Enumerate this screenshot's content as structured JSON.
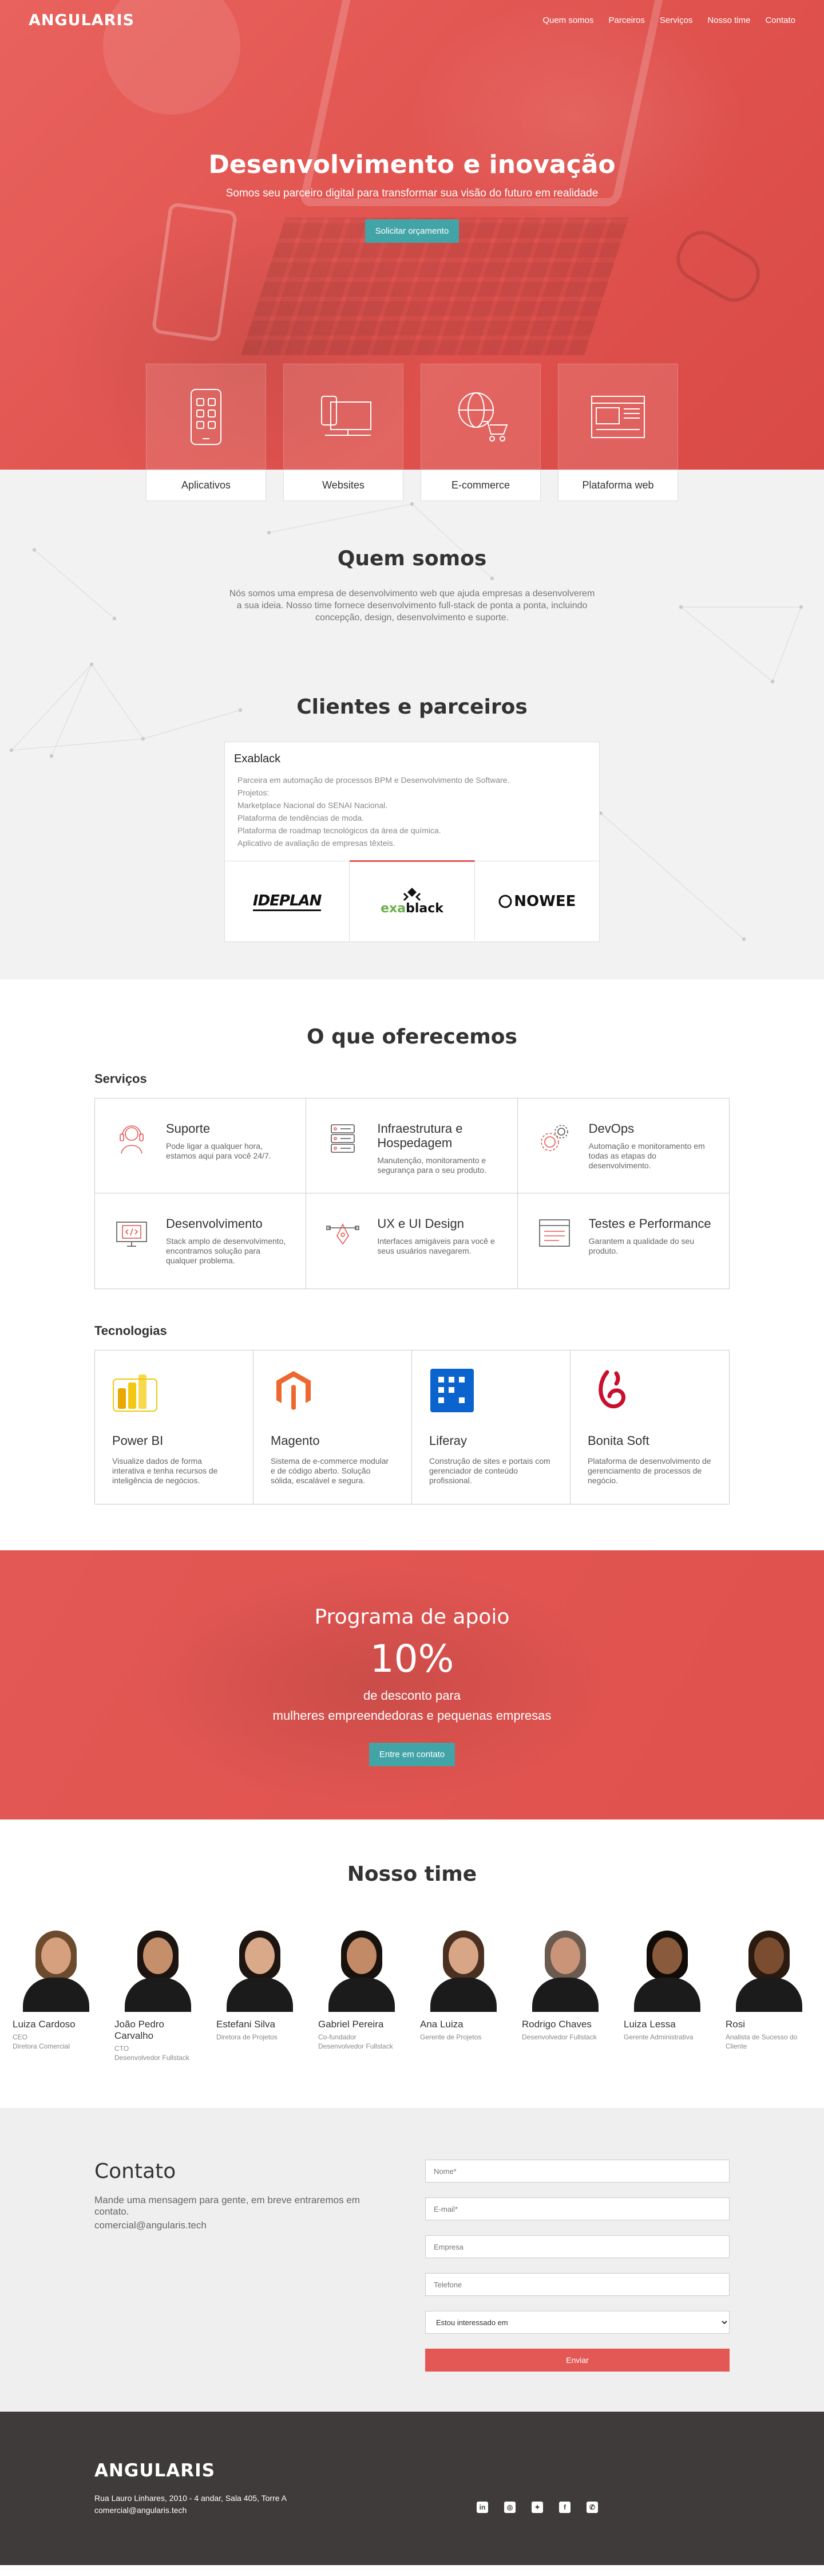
{
  "nav": {
    "logo": "ANGULARIS",
    "links": [
      "Quem somos",
      "Parceiros",
      "Serviços",
      "Nosso time",
      "Contato"
    ]
  },
  "hero": {
    "title": "Desenvolvimento e inovação",
    "subtitle": "Somos seu parceiro digital para transformar sua visão do futuro em realidade",
    "cta": "Solicitar orçamento"
  },
  "cards": [
    {
      "label": "Aplicativos",
      "icon": "mobile-app-icon"
    },
    {
      "label": "Websites",
      "icon": "desktop-icon"
    },
    {
      "label": "E-commerce",
      "icon": "shopping-cart-globe-icon"
    },
    {
      "label": "Plataforma web",
      "icon": "web-platform-icon"
    }
  ],
  "about": {
    "title": "Quem somos",
    "text": "Nós somos uma empresa de desenvolvimento web que ajuda empresas a desenvolverem a sua ideia. Nosso time fornece desenvolvimento full-stack de ponta a ponta, incluindo concepção, design, desenvolvimento e suporte."
  },
  "clients": {
    "title": "Clientes e parceiros",
    "active": "Exablack",
    "items": [
      "Parceira em automação de processos BPM e Desenvolvimento de Software.",
      "Projetos:",
      "Marketplace Nacional do SENAI Nacional.",
      "Plataforma de tendências de moda.",
      "Plataforma de roadmap tecnológicos da área de química.",
      "Aplicativo de avaliação de empresas têxteis."
    ],
    "logos": [
      "IDEPLAN",
      "exablack",
      "NOWEE"
    ]
  },
  "offer": {
    "title": "O que oferecemos",
    "services_title": "Serviços",
    "tech_title": "Tecnologias",
    "services": [
      {
        "name": "Suporte",
        "desc": "Pode ligar a qualquer hora, estamos aqui para você 24/7."
      },
      {
        "name": "Infraestrutura e Hospedagem",
        "desc": "Manutenção, monitoramento e segurança para o seu produto."
      },
      {
        "name": "DevOps",
        "desc": "Automação e monitoramento em todas as etapas do desenvolvimento."
      },
      {
        "name": "Desenvolvimento",
        "desc": "Stack amplo de desenvolvimento, encontramos solução para qualquer problema."
      },
      {
        "name": "UX e UI Design",
        "desc": "Interfaces amigáveis para você e seus usuários navegarem."
      },
      {
        "name": "Testes e Performance",
        "desc": "Garantem a qualidade do seu produto."
      }
    ],
    "techs": [
      {
        "name": "Power BI",
        "desc": "Visualize dados de forma interativa e tenha recursos de inteligência de negócios.",
        "color": "#f2c811"
      },
      {
        "name": "Magento",
        "desc": "Sistema de e-commerce modular e de código aberto. Solução sólida, escalável e segura.",
        "color": "#ee672f"
      },
      {
        "name": "Liferay",
        "desc": "Construção de sites e portais com gerenciador de conteúdo profissional.",
        "color": "#0b63ce"
      },
      {
        "name": "Bonita Soft",
        "desc": "Plataforma de desenvolvimento de gerenciamento de processos de negócio.",
        "color": "#c8102e"
      }
    ]
  },
  "promo": {
    "title": "Programa de apoio",
    "percent": "10%",
    "line1": "de desconto para",
    "line2": "mulheres empreendedoras e pequenas empresas",
    "cta": "Entre em contato"
  },
  "team": {
    "title": "Nosso time",
    "members": [
      {
        "name": "Luiza Cardoso",
        "role1": "CEO",
        "role2": "Diretora Comercial",
        "hair": "#6b4a2e",
        "skin": "#d6a07e"
      },
      {
        "name": "João Pedro Carvalho",
        "role1": "CTO",
        "role2": "Desenvolvedor Fullstack",
        "hair": "#1c1410",
        "skin": "#c58f6c"
      },
      {
        "name": "Estefani Silva",
        "role1": "Diretora de Projetos",
        "role2": "",
        "hair": "#1d1511",
        "skin": "#d9a98a"
      },
      {
        "name": "Gabriel Pereira",
        "role1": "Co-fundador",
        "role2": "Desenvolvedor Fullstack",
        "hair": "#18120e",
        "skin": "#c28a66"
      },
      {
        "name": "Ana Luiza",
        "role1": "Gerente de Projetos",
        "role2": "",
        "hair": "#4a3020",
        "skin": "#d8a586"
      },
      {
        "name": "Rodrigo Chaves",
        "role1": "Desenvolvedor Fullstack",
        "role2": "",
        "hair": "#6a5a50",
        "skin": "#c99477"
      },
      {
        "name": "Luiza Lessa",
        "role1": "Gerente Administrativa",
        "role2": "",
        "hair": "#120c09",
        "skin": "#8a5a3c"
      },
      {
        "name": "Rosi",
        "role1": "Analista de Sucesso do Cliente",
        "role2": "",
        "hair": "#2a1a10",
        "skin": "#7a4c30"
      }
    ]
  },
  "contact": {
    "title": "Contato",
    "text": "Mande uma mensagem para gente, em breve entraremos em contato.",
    "email": "comercial@angularis.tech",
    "placeholders": {
      "name": "Nome*",
      "email": "E-mail*",
      "company": "Empresa",
      "phone": "Telefone"
    },
    "select": "Estou interessado em",
    "submit": "Enviar"
  },
  "footer": {
    "logo": "ANGULARIS",
    "address": "Rua Lauro Linhares, 2010 - 4 andar, Sala 405, Torre A",
    "email": "comercial@angularis.tech",
    "socials": [
      {
        "icon": "linkedin-icon",
        "glyph": "in"
      },
      {
        "icon": "instagram-icon",
        "glyph": "◎"
      },
      {
        "icon": "twitter-icon",
        "glyph": "✦"
      },
      {
        "icon": "facebook-icon",
        "glyph": "f"
      },
      {
        "icon": "whatsapp-icon",
        "glyph": "✆"
      }
    ]
  },
  "colors": {
    "brand": "#e35854",
    "teal": "#43a4a8",
    "footer": "#3f3b3b"
  }
}
